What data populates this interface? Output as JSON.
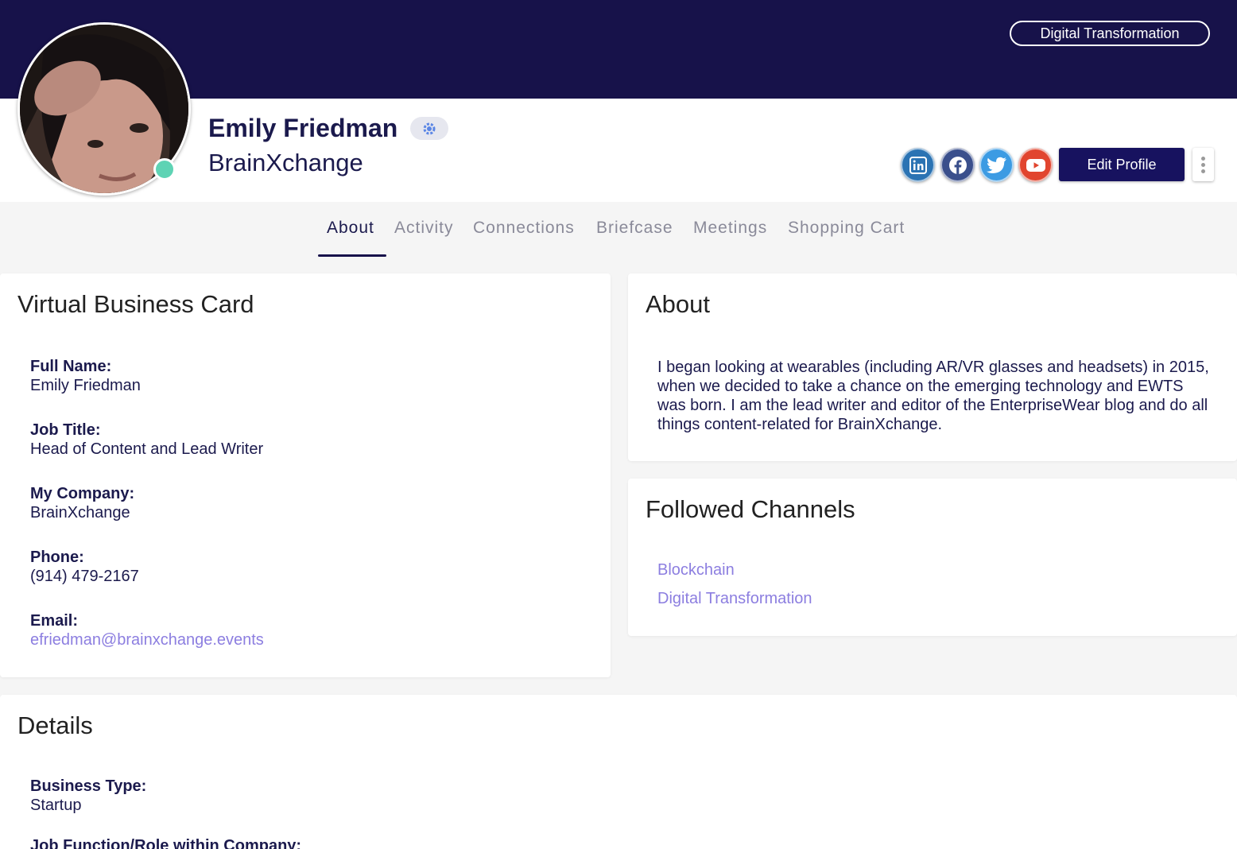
{
  "header": {
    "channel_pill": "Digital Transformation"
  },
  "profile": {
    "name": "Emily Friedman",
    "company": "BrainXchange",
    "online_status_color": "#5ed3b4",
    "badge_icon": "user-gear-icon",
    "social": [
      {
        "name": "linkedin",
        "icon": "linkedin-icon",
        "color": "#2b73b3"
      },
      {
        "name": "facebook",
        "icon": "facebook-icon",
        "color": "#3a4f8c"
      },
      {
        "name": "twitter",
        "icon": "twitter-icon",
        "color": "#3c9be3"
      },
      {
        "name": "youtube",
        "icon": "youtube-icon",
        "color": "#e1452f"
      }
    ],
    "edit_label": "Edit Profile",
    "more_icon": "more-vertical-icon"
  },
  "tabs": [
    {
      "label": "About",
      "active": true
    },
    {
      "label": "Activity",
      "active": false
    },
    {
      "label": "Connections",
      "active": false
    },
    {
      "label": "Briefcase",
      "active": false
    },
    {
      "label": "Meetings",
      "active": false
    },
    {
      "label": "Shopping Cart",
      "active": false
    }
  ],
  "business_card": {
    "title": "Virtual Business Card",
    "fields": [
      {
        "label": "Full Name:",
        "value": "Emily Friedman"
      },
      {
        "label": "Job Title:",
        "value": "Head of Content and Lead Writer"
      },
      {
        "label": "My Company:",
        "value": "BrainXchange"
      },
      {
        "label": "Phone:",
        "value": "(914) 479-2167"
      },
      {
        "label": "Email:",
        "value": "efriedman@brainxchange.events"
      }
    ]
  },
  "about": {
    "title": "About",
    "text": "I began looking at wearables (including AR/VR glasses and headsets) in 2015, when we decided to take a chance on the emerging technology and EWTS was born. I am the lead writer and editor of the EnterpriseWear blog and do all things content-related for BrainXchange."
  },
  "followed_channels": {
    "title": "Followed Channels",
    "items": [
      "Blockchain",
      "Digital Transformation"
    ]
  },
  "details": {
    "title": "Details",
    "fields": [
      {
        "label": "Business Type:",
        "value": "Startup"
      },
      {
        "label": "Job Function/Role within Company:",
        "value": ""
      }
    ]
  },
  "colors": {
    "banner": "#17124a",
    "primary_button": "#17125f",
    "link": "#8c7ee0"
  }
}
